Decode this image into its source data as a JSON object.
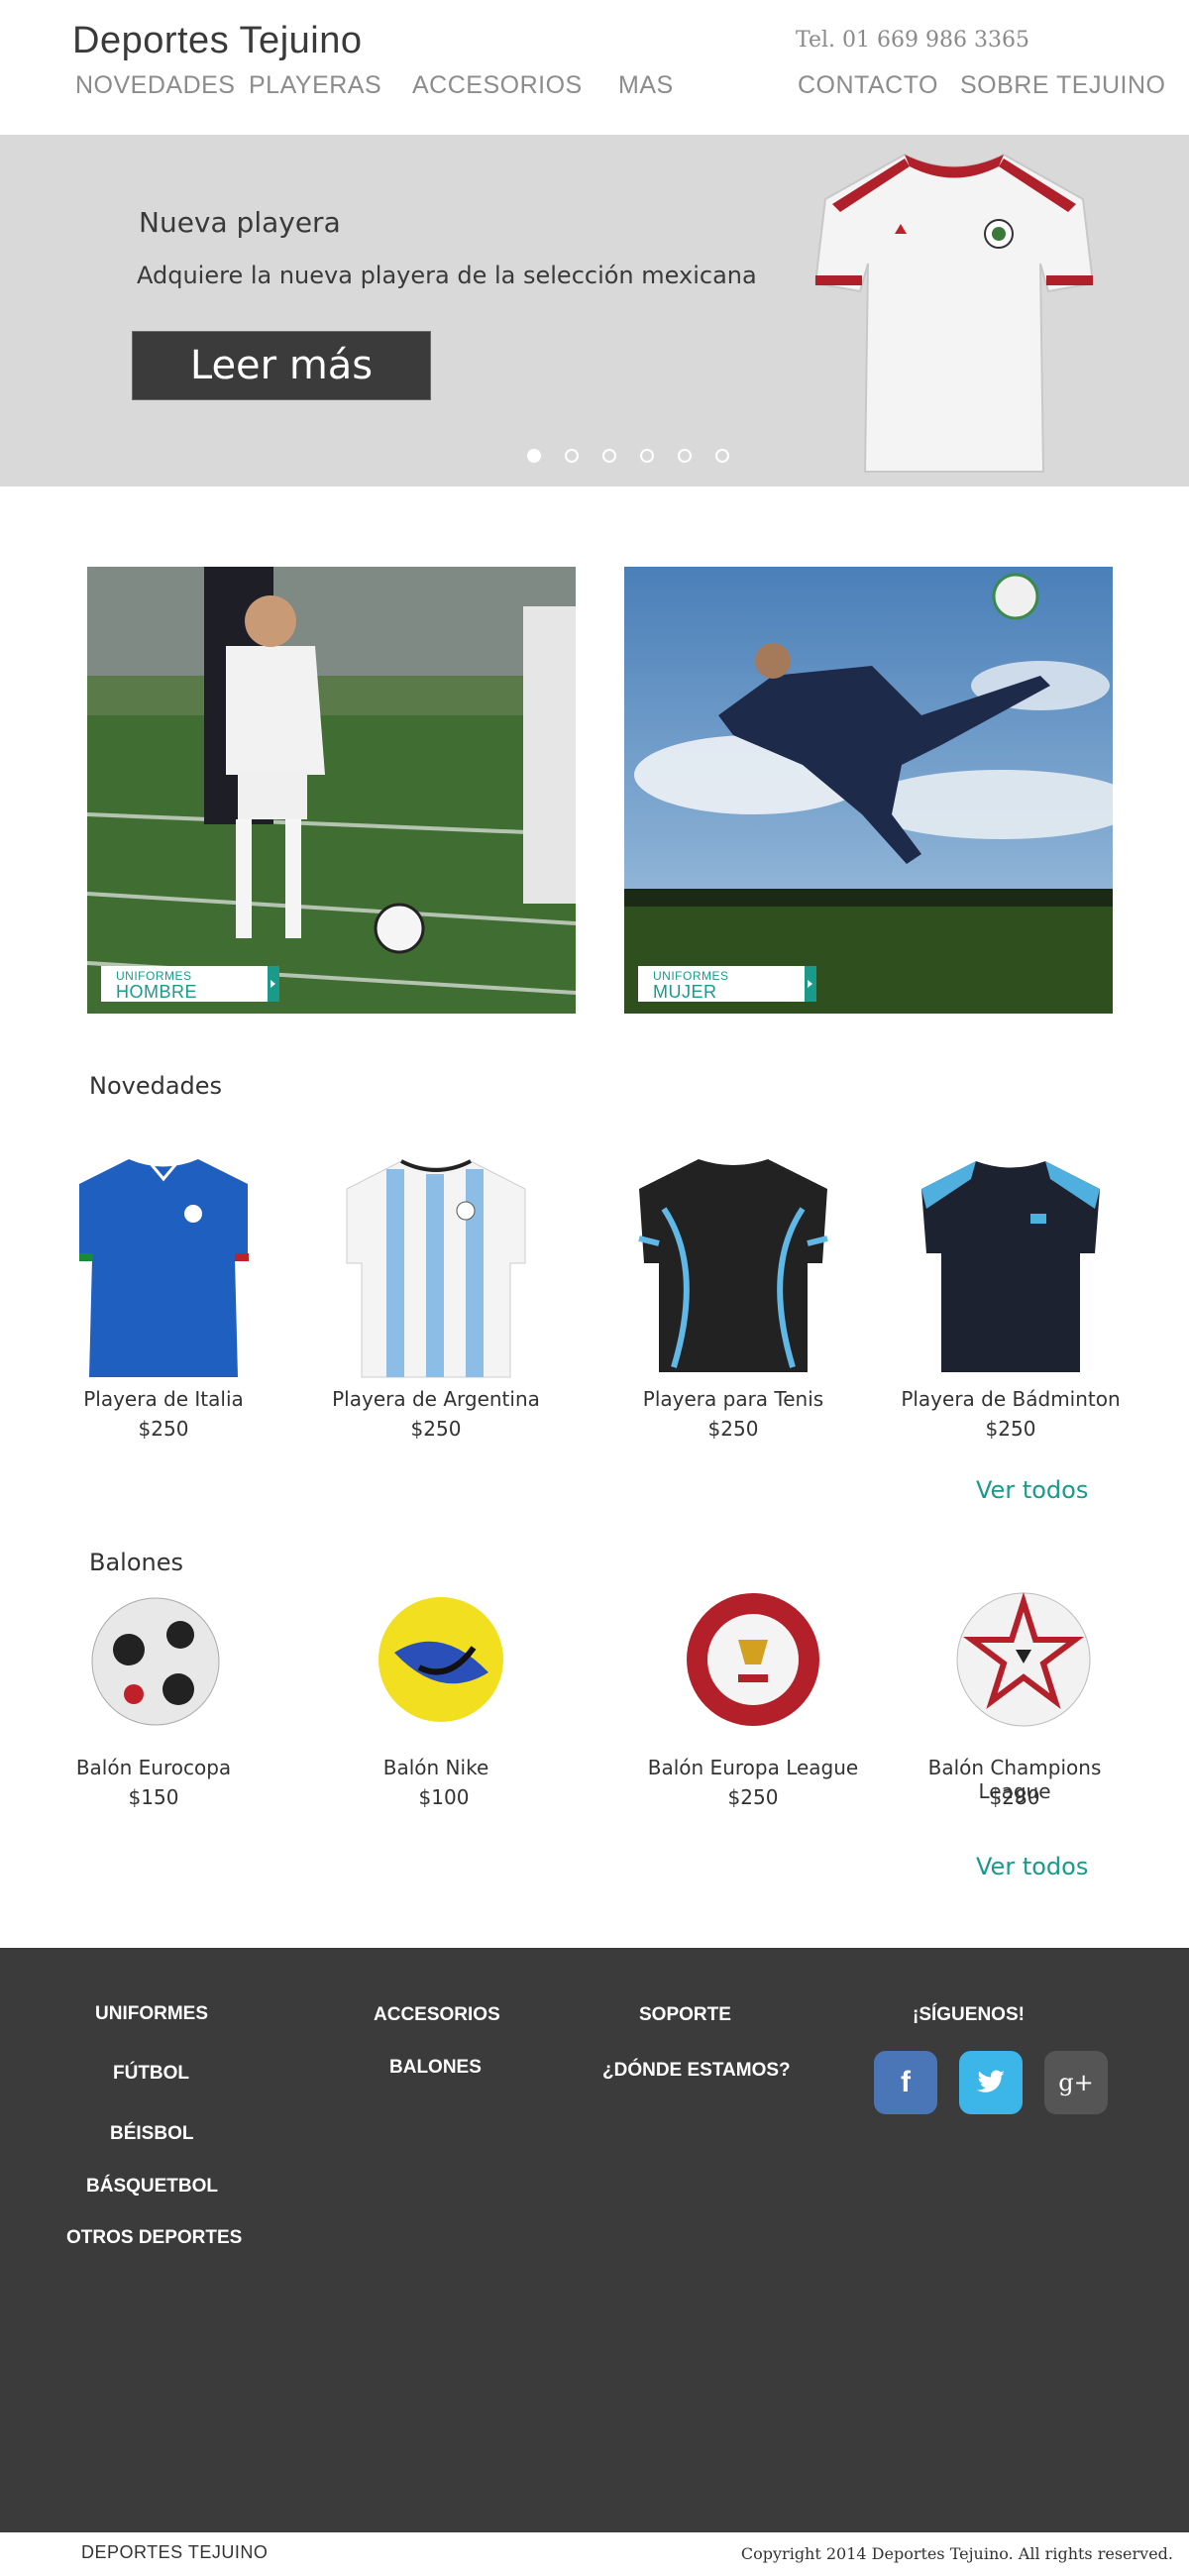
{
  "header": {
    "brand": "Deportes Tejuino",
    "phone": "Tel. 01 669 986 3365",
    "nav": [
      "NOVEDADES",
      "PLAYERAS",
      "ACCESORIOS",
      "MAS",
      "CONTACTO",
      "SOBRE TEJUINO"
    ]
  },
  "hero": {
    "title": "Nueva playera",
    "subtitle": "Adquiere la nueva  playera de la selección mexicana",
    "button": "Leer más",
    "slides": 6,
    "active_slide": 1
  },
  "promos": [
    {
      "small": "UNIFORMES",
      "big": "HOMBRE"
    },
    {
      "small": "UNIFORMES",
      "big": "MUJER"
    }
  ],
  "novedades": {
    "title": "Novedades",
    "products": [
      {
        "name": "Playera de Italia",
        "price": "$250"
      },
      {
        "name": "Playera de Argentina",
        "price": "$250"
      },
      {
        "name": "Playera para Tenis",
        "price": "$250"
      },
      {
        "name": "Playera de Bádminton",
        "price": "$250"
      }
    ],
    "see_all": "Ver todos"
  },
  "balones": {
    "title": "Balones",
    "products": [
      {
        "name": "Balón Eurocopa",
        "price": "$150"
      },
      {
        "name": "Balón Nike",
        "price": "$100"
      },
      {
        "name": "Balón Europa League",
        "price": "$250"
      },
      {
        "name": "Balón Champions League",
        "price": "$280"
      }
    ],
    "see_all": "Ver todos"
  },
  "footer": {
    "col1": [
      "UNIFORMES",
      "FÚTBOL",
      "BÉISBOL",
      "BÁSQUETBOL",
      "OTROS DEPORTES"
    ],
    "col2": [
      "ACCESORIOS",
      "BALONES"
    ],
    "col3": [
      "SOPORTE",
      "¿DÓNDE ESTAMOS?"
    ],
    "follow": "¡SÍGUENOS!",
    "social": [
      "facebook-icon",
      "twitter-icon",
      "google-plus-icon"
    ]
  },
  "bottom": {
    "brand": "DEPORTES TEJUINO",
    "copyright": "Copyright 2014 Deportes Tejuino. All rights reserved."
  },
  "colors": {
    "accent": "#1a9a8a",
    "dark": "#3b3b3b",
    "hero_bg": "#d9d9d9",
    "facebook": "#4a76b8",
    "twitter": "#3cb6e8",
    "googleplus": "#555555"
  }
}
